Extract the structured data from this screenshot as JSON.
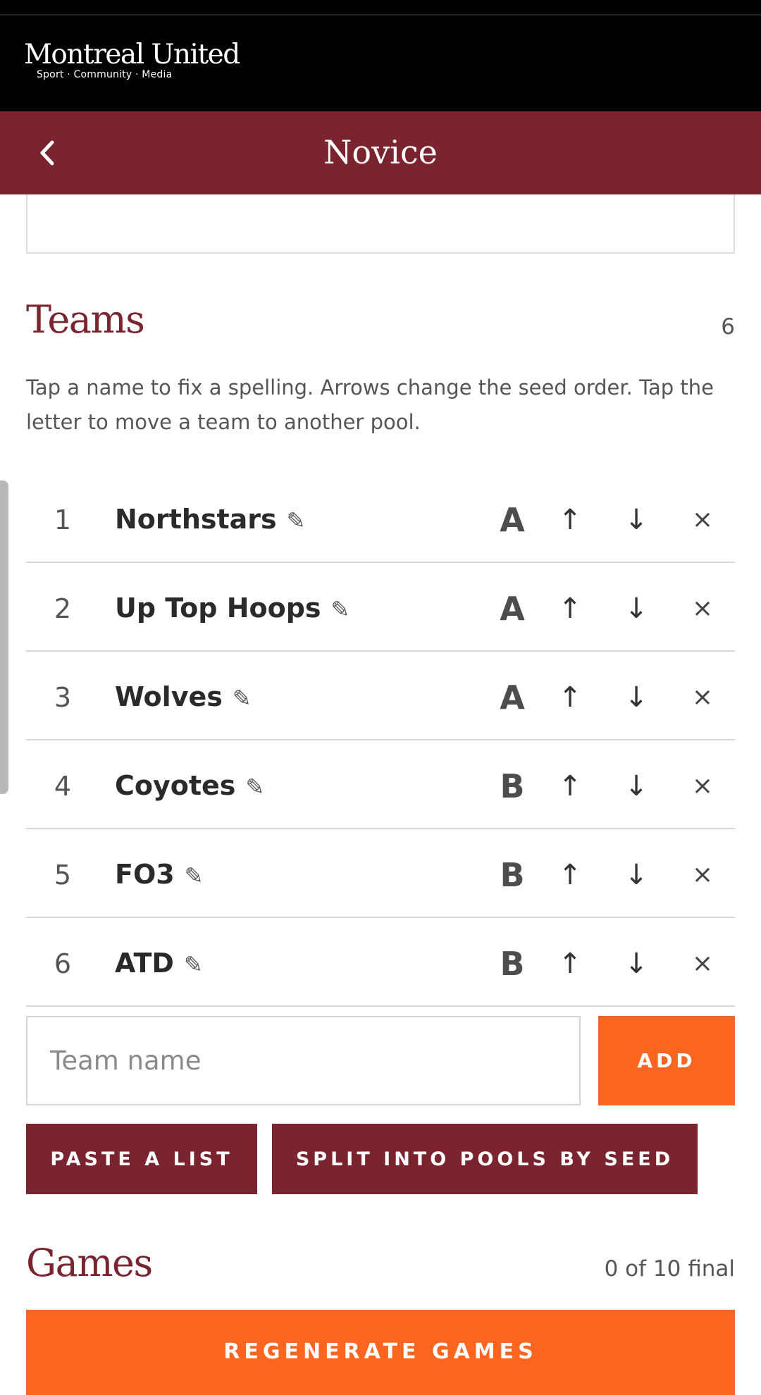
{
  "brand": {
    "name": "Montreal United",
    "tagline": "Sport · Community · Media"
  },
  "header": {
    "title": "Novice",
    "back_icon": "chevron-left-icon"
  },
  "teams_section": {
    "title": "Teams",
    "count": "6",
    "help_text": "Tap a name to fix a spelling. Arrows change the seed order. Tap the letter to move a team to another pool."
  },
  "teams": [
    {
      "seed": "1",
      "name": "Northstars",
      "pool": "A"
    },
    {
      "seed": "2",
      "name": "Up Top Hoops",
      "pool": "A"
    },
    {
      "seed": "3",
      "name": "Wolves",
      "pool": "A"
    },
    {
      "seed": "4",
      "name": "Coyotes",
      "pool": "B"
    },
    {
      "seed": "5",
      "name": "FO3",
      "pool": "B"
    },
    {
      "seed": "6",
      "name": "ATD",
      "pool": "B"
    }
  ],
  "row_icons": {
    "edit": "✎",
    "up": "↑",
    "down": "↓",
    "remove": "×"
  },
  "add_team": {
    "placeholder": "Team name",
    "value": "",
    "button_label": "ADD"
  },
  "actions": {
    "paste_label": "PASTE A LIST",
    "split_label": "SPLIT INTO POOLS BY SEED"
  },
  "games_section": {
    "title": "Games",
    "status": "0 of 10 final",
    "regenerate_label": "REGENERATE GAMES"
  },
  "colors": {
    "brand_maroon": "#7a2430",
    "accent_orange": "#fa6520",
    "header_black": "#000000"
  }
}
